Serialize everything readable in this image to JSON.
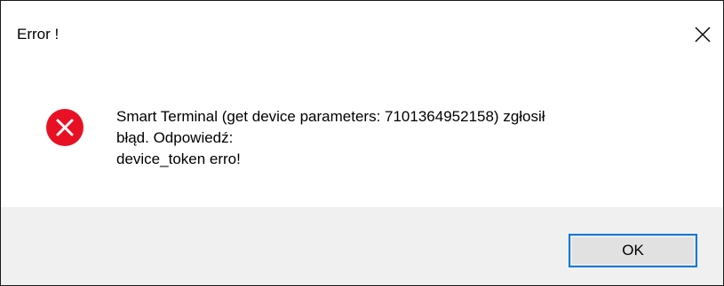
{
  "window": {
    "title": "Error !",
    "close_icon": "close-icon"
  },
  "message": {
    "icon": "error-icon",
    "lines": [
      "Smart Terminal (get device parameters: 7101364952158) zgłosił",
      "błąd. Odpowiedź:",
      "device_token erro!"
    ]
  },
  "buttons": {
    "ok_label": "OK"
  },
  "colors": {
    "error_red": "#e81123",
    "focus_blue": "#0078d7",
    "footer_bg": "#f0f0f0"
  }
}
